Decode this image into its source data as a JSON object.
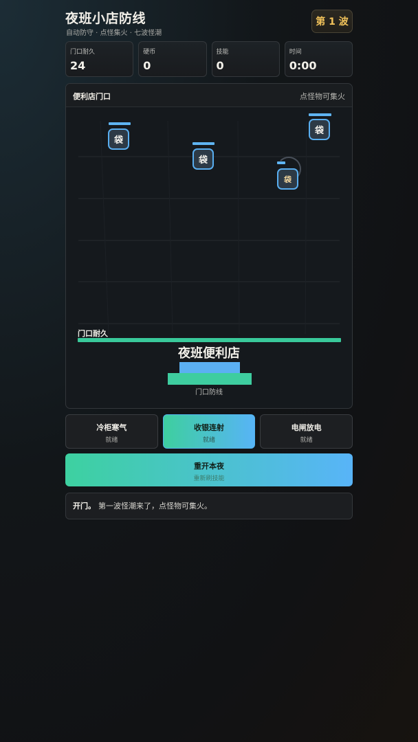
{
  "header": {
    "title": "夜班小店防线",
    "subtitle": "自动防守 · 点怪集火 · 七波怪潮",
    "wave_badge": "第 1 波"
  },
  "stats": [
    {
      "label": "门口耐久",
      "value": "24"
    },
    {
      "label": "硬币",
      "value": "0"
    },
    {
      "label": "技能",
      "value": "0"
    },
    {
      "label": "时间",
      "value": "0:00"
    }
  ],
  "arena": {
    "title": "便利店门口",
    "hint": "点怪物可集火",
    "door_label": "门口耐久",
    "door_hp_fraction": 1.0,
    "store_name": "夜班便利店",
    "store_caption": "门口防线",
    "enemies": [
      {
        "glyph": "袋",
        "hp_fraction": 1.0,
        "type": "bag"
      },
      {
        "glyph": "袋",
        "hp_fraction": 1.0,
        "type": "bag"
      },
      {
        "glyph": "袋",
        "hp_fraction": 0.4,
        "type": "bag-yellow",
        "frozen": true
      },
      {
        "glyph": "袋",
        "hp_fraction": 1.0,
        "type": "bag"
      }
    ]
  },
  "skills": [
    {
      "name": "冷柜寒气",
      "state": "就绪",
      "active": false
    },
    {
      "name": "收银连射",
      "state": "就绪",
      "active": true
    },
    {
      "name": "电闸放电",
      "state": "就绪",
      "active": false
    }
  ],
  "restart": {
    "label": "重开本夜",
    "sub": "重新刷技能"
  },
  "log": {
    "strong": "开门。",
    "text": "第一波怪潮来了，点怪物可集火。"
  },
  "colors": {
    "accent_green": "#3ecf9f",
    "accent_blue": "#57b4f6",
    "wave_gold": "#f2c35b",
    "enemy_border": "#59aef0"
  }
}
